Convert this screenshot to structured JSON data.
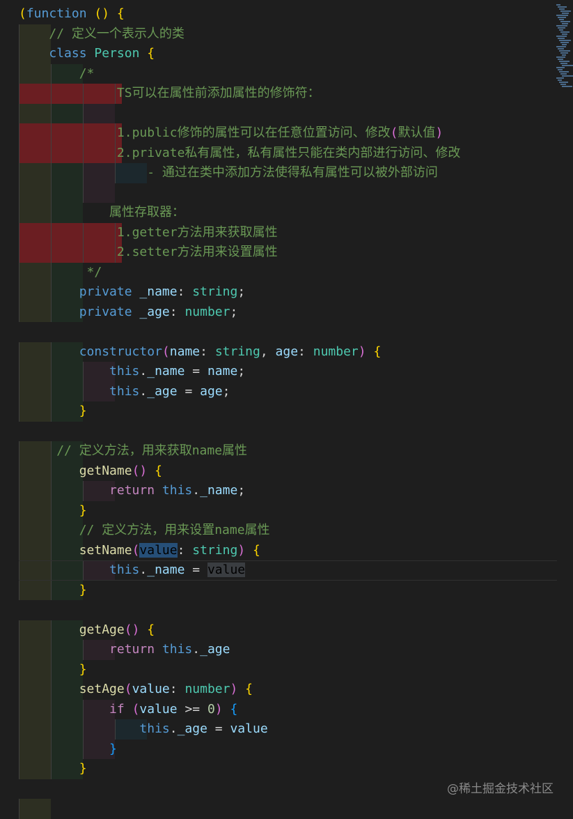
{
  "editor": {
    "lines": [
      {
        "bands": [],
        "tokens": [
          [
            "paren",
            "("
          ],
          [
            "kw",
            "function"
          ],
          [
            "op",
            " "
          ],
          [
            "paren",
            "()"
          ],
          [
            "op",
            " "
          ],
          [
            "paren",
            "{"
          ]
        ]
      },
      {
        "bands": [
          "b1"
        ],
        "tokens": [
          [
            "op",
            "    "
          ],
          [
            "cm",
            "// 定义一个表示人的类"
          ]
        ]
      },
      {
        "bands": [
          "b1"
        ],
        "tokens": [
          [
            "op",
            "    "
          ],
          [
            "kw",
            "class"
          ],
          [
            "op",
            " "
          ],
          [
            "cls",
            "Person"
          ],
          [
            "op",
            " "
          ],
          [
            "paren",
            "{"
          ]
        ]
      },
      {
        "bands": [
          "b1",
          "b2"
        ],
        "tokens": [
          [
            "op",
            "        "
          ],
          [
            "cm",
            "/*"
          ]
        ]
      },
      {
        "bands": [
          "err"
        ],
        "tokens": [
          [
            "op",
            "             "
          ],
          [
            "cm",
            "TS可以在属性前添加属性的修饰符："
          ]
        ]
      },
      {
        "bands": [
          "b1",
          "b2",
          "b3"
        ],
        "tokens": []
      },
      {
        "bands": [
          "err"
        ],
        "tokens": [
          [
            "op",
            "             "
          ],
          [
            "cm",
            "1.public修饰的属性可以在任意位置访问、修改"
          ],
          [
            "br2",
            "("
          ],
          [
            "cm",
            "默认值"
          ],
          [
            "br2",
            ")"
          ]
        ]
      },
      {
        "bands": [
          "err"
        ],
        "tokens": [
          [
            "op",
            "             "
          ],
          [
            "cm",
            "2.private私有属性，私有属性只能在类内部进行访问、修改"
          ]
        ]
      },
      {
        "bands": [
          "b1",
          "b2",
          "b3",
          "b4"
        ],
        "tokens": [
          [
            "op",
            "                 "
          ],
          [
            "cm",
            "- 通过在类中添加方法使得私有属性可以被外部访问"
          ]
        ]
      },
      {
        "bands": [
          "b1",
          "b2",
          "b3"
        ],
        "tokens": []
      },
      {
        "bands": [
          "b1",
          "b2"
        ],
        "tokens": [
          [
            "op",
            "            "
          ],
          [
            "cm",
            "属性存取器："
          ]
        ]
      },
      {
        "bands": [
          "err"
        ],
        "tokens": [
          [
            "op",
            "             "
          ],
          [
            "cm",
            "1.getter方法用来获取属性"
          ]
        ]
      },
      {
        "bands": [
          "err"
        ],
        "tokens": [
          [
            "op",
            "             "
          ],
          [
            "cm",
            "2.setter方法用来设置属性"
          ]
        ]
      },
      {
        "bands": [
          "b1",
          "b2"
        ],
        "tokens": [
          [
            "op",
            "         "
          ],
          [
            "cm",
            "*/"
          ]
        ]
      },
      {
        "bands": [
          "b1",
          "b2"
        ],
        "tokens": [
          [
            "op",
            "        "
          ],
          [
            "kw",
            "private"
          ],
          [
            "op",
            " "
          ],
          [
            "var",
            "_name"
          ],
          [
            "op",
            ": "
          ],
          [
            "type",
            "string"
          ],
          [
            "op",
            ";"
          ]
        ]
      },
      {
        "bands": [
          "b1",
          "b2"
        ],
        "tokens": [
          [
            "op",
            "        "
          ],
          [
            "kw",
            "private"
          ],
          [
            "op",
            " "
          ],
          [
            "var",
            "_age"
          ],
          [
            "op",
            ": "
          ],
          [
            "type",
            "number"
          ],
          [
            "op",
            ";"
          ]
        ]
      },
      {
        "bands": [],
        "tokens": []
      },
      {
        "bands": [
          "b1",
          "b2"
        ],
        "tokens": [
          [
            "op",
            "        "
          ],
          [
            "kw",
            "constructor"
          ],
          [
            "br2",
            "("
          ],
          [
            "var",
            "name"
          ],
          [
            "op",
            ": "
          ],
          [
            "type",
            "string"
          ],
          [
            "op",
            ", "
          ],
          [
            "var",
            "age"
          ],
          [
            "op",
            ": "
          ],
          [
            "type",
            "number"
          ],
          [
            "br2",
            ")"
          ],
          [
            "op",
            " "
          ],
          [
            "paren",
            "{"
          ]
        ]
      },
      {
        "bands": [
          "b1",
          "b2",
          "b3"
        ],
        "tokens": [
          [
            "op",
            "            "
          ],
          [
            "kw",
            "this"
          ],
          [
            "op",
            "."
          ],
          [
            "var",
            "_name"
          ],
          [
            "op",
            " = "
          ],
          [
            "var",
            "name"
          ],
          [
            "op",
            ";"
          ]
        ]
      },
      {
        "bands": [
          "b1",
          "b2",
          "b3"
        ],
        "tokens": [
          [
            "op",
            "            "
          ],
          [
            "kw",
            "this"
          ],
          [
            "op",
            "."
          ],
          [
            "var",
            "_age"
          ],
          [
            "op",
            " = "
          ],
          [
            "var",
            "age"
          ],
          [
            "op",
            ";"
          ]
        ]
      },
      {
        "bands": [
          "b1",
          "b2"
        ],
        "tokens": [
          [
            "op",
            "        "
          ],
          [
            "paren",
            "}"
          ]
        ]
      },
      {
        "bands": [],
        "tokens": []
      },
      {
        "bands": [
          "b1",
          "b2"
        ],
        "tokens": [
          [
            "op",
            "     "
          ],
          [
            "cm",
            "// 定义方法，用来获取name属性"
          ]
        ]
      },
      {
        "bands": [
          "b1",
          "b2"
        ],
        "tokens": [
          [
            "op",
            "        "
          ],
          [
            "fn",
            "getName"
          ],
          [
            "br2",
            "()"
          ],
          [
            "op",
            " "
          ],
          [
            "paren",
            "{"
          ]
        ]
      },
      {
        "bands": [
          "b1",
          "b2",
          "b3"
        ],
        "tokens": [
          [
            "op",
            "            "
          ],
          [
            "ctrl",
            "return"
          ],
          [
            "op",
            " "
          ],
          [
            "kw",
            "this"
          ],
          [
            "op",
            "."
          ],
          [
            "var",
            "_name"
          ],
          [
            "op",
            ";"
          ]
        ]
      },
      {
        "bands": [
          "b1",
          "b2"
        ],
        "tokens": [
          [
            "op",
            "        "
          ],
          [
            "paren",
            "}"
          ]
        ]
      },
      {
        "bands": [
          "b1",
          "b2"
        ],
        "tokens": [
          [
            "op",
            "        "
          ],
          [
            "cm",
            "// 定义方法，用来设置name属性"
          ]
        ]
      },
      {
        "bands": [
          "b1",
          "b2"
        ],
        "tokens": [
          [
            "op",
            "        "
          ],
          [
            "fn",
            "setName"
          ],
          [
            "br2",
            "("
          ],
          [
            "hl",
            "value"
          ],
          [
            "op",
            ": "
          ],
          [
            "type",
            "string"
          ],
          [
            "br2",
            ")"
          ],
          [
            "op",
            " "
          ],
          [
            "paren",
            "{"
          ]
        ]
      },
      {
        "bands": [
          "b1",
          "b2",
          "b3"
        ],
        "current": true,
        "tokens": [
          [
            "op",
            "            "
          ],
          [
            "kw",
            "this"
          ],
          [
            "op",
            "."
          ],
          [
            "var",
            "_name"
          ],
          [
            "op",
            " = "
          ],
          [
            "hl2",
            "value"
          ]
        ]
      },
      {
        "bands": [
          "b1",
          "b2"
        ],
        "tokens": [
          [
            "op",
            "        "
          ],
          [
            "paren",
            "}"
          ]
        ]
      },
      {
        "bands": [],
        "tokens": []
      },
      {
        "bands": [
          "b1",
          "b2"
        ],
        "tokens": [
          [
            "op",
            "        "
          ],
          [
            "fn",
            "getAge"
          ],
          [
            "br2",
            "()"
          ],
          [
            "op",
            " "
          ],
          [
            "paren",
            "{"
          ]
        ]
      },
      {
        "bands": [
          "b1",
          "b2",
          "b3"
        ],
        "tokens": [
          [
            "op",
            "            "
          ],
          [
            "ctrl",
            "return"
          ],
          [
            "op",
            " "
          ],
          [
            "kw",
            "this"
          ],
          [
            "op",
            "."
          ],
          [
            "var",
            "_age"
          ]
        ]
      },
      {
        "bands": [
          "b1",
          "b2"
        ],
        "tokens": [
          [
            "op",
            "        "
          ],
          [
            "paren",
            "}"
          ]
        ]
      },
      {
        "bands": [
          "b1",
          "b2"
        ],
        "tokens": [
          [
            "op",
            "        "
          ],
          [
            "fn",
            "setAge"
          ],
          [
            "br2",
            "("
          ],
          [
            "var",
            "value"
          ],
          [
            "op",
            ": "
          ],
          [
            "type",
            "number"
          ],
          [
            "br2",
            ")"
          ],
          [
            "op",
            " "
          ],
          [
            "paren",
            "{"
          ]
        ]
      },
      {
        "bands": [
          "b1",
          "b2",
          "b3"
        ],
        "tokens": [
          [
            "op",
            "            "
          ],
          [
            "ctrl",
            "if"
          ],
          [
            "op",
            " "
          ],
          [
            "br2",
            "("
          ],
          [
            "var",
            "value"
          ],
          [
            "op",
            " >= "
          ],
          [
            "num",
            "0"
          ],
          [
            "br2",
            ")"
          ],
          [
            "op",
            " "
          ],
          [
            "br3",
            "{"
          ]
        ]
      },
      {
        "bands": [
          "b1",
          "b2",
          "b3",
          "b4"
        ],
        "tokens": [
          [
            "op",
            "                "
          ],
          [
            "kw",
            "this"
          ],
          [
            "op",
            "."
          ],
          [
            "var",
            "_age"
          ],
          [
            "op",
            " = "
          ],
          [
            "var",
            "value"
          ]
        ]
      },
      {
        "bands": [
          "b1",
          "b2",
          "b3"
        ],
        "tokens": [
          [
            "op",
            "            "
          ],
          [
            "br3",
            "}"
          ]
        ]
      },
      {
        "bands": [
          "b1",
          "b2"
        ],
        "tokens": [
          [
            "op",
            "        "
          ],
          [
            "paren",
            "}"
          ]
        ]
      },
      {
        "bands": [],
        "tokens": []
      },
      {
        "bands": [
          "b1"
        ],
        "tokens": []
      }
    ]
  },
  "watermark": "@稀土掘金技术社区"
}
